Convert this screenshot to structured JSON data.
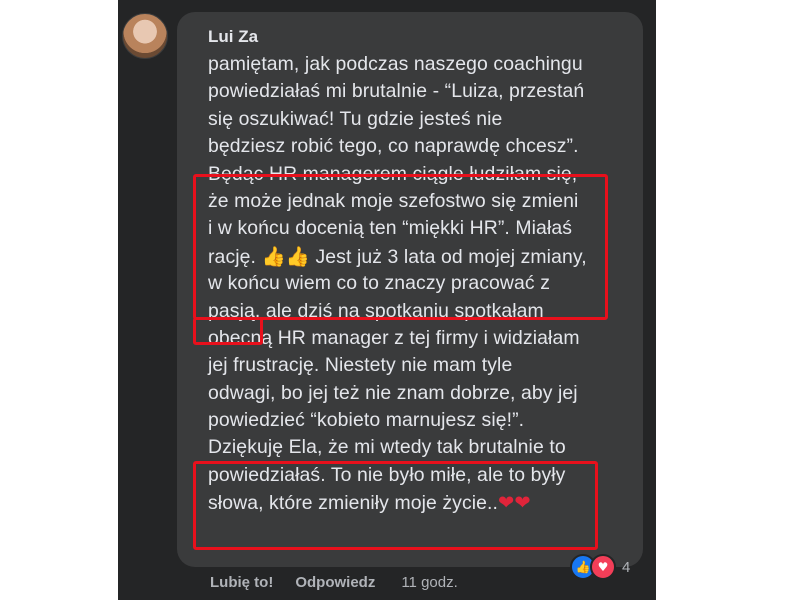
{
  "comment": {
    "author": "Lui Za",
    "lines": [
      "pamiętam, jak podczas naszego coachingu",
      "powiedziałaś mi brutalnie - “Luiza, przestań",
      "się oszukiwać! Tu gdzie jesteś nie",
      "będziesz robić tego, co naprawdę chcesz”.",
      "Będąc HR managerem ciągle łudziłam się,",
      "że może jednak moje szefostwo się zmieni",
      "i w końcu docenią ten “miękki HR”. Miałaś",
      "rację. ",
      " Jest już 3 lata od mojej zmiany,",
      "w końcu wiem co to znaczy pracować z",
      "pasją, ale dziś na spotkaniu spotkałam",
      "obecną HR manager z tej firmy i widziałam",
      "jej frustrację. Niestety nie mam tyle",
      "odwagi, bo jej też nie znam dobrze, aby jej",
      "powiedzieć “kobieto marnujesz się!”.",
      "Dziękuję Ela, że mi wtedy tak brutalnie to",
      "powiedziałaś. To nie było miłe, ale to były",
      "słowa, które zmieniły moje życie.."
    ],
    "thumbs": "👍👍",
    "hearts": "❤❤"
  },
  "reactions": {
    "like": "👍",
    "love": "♥",
    "count": "4"
  },
  "actions": {
    "like": "Lubię to!",
    "reply": "Odpowiedz",
    "time": "11 godz."
  },
  "colors": {
    "highlight": "#e8101c",
    "bubble": "#3a3b3c",
    "panel": "#242526"
  }
}
